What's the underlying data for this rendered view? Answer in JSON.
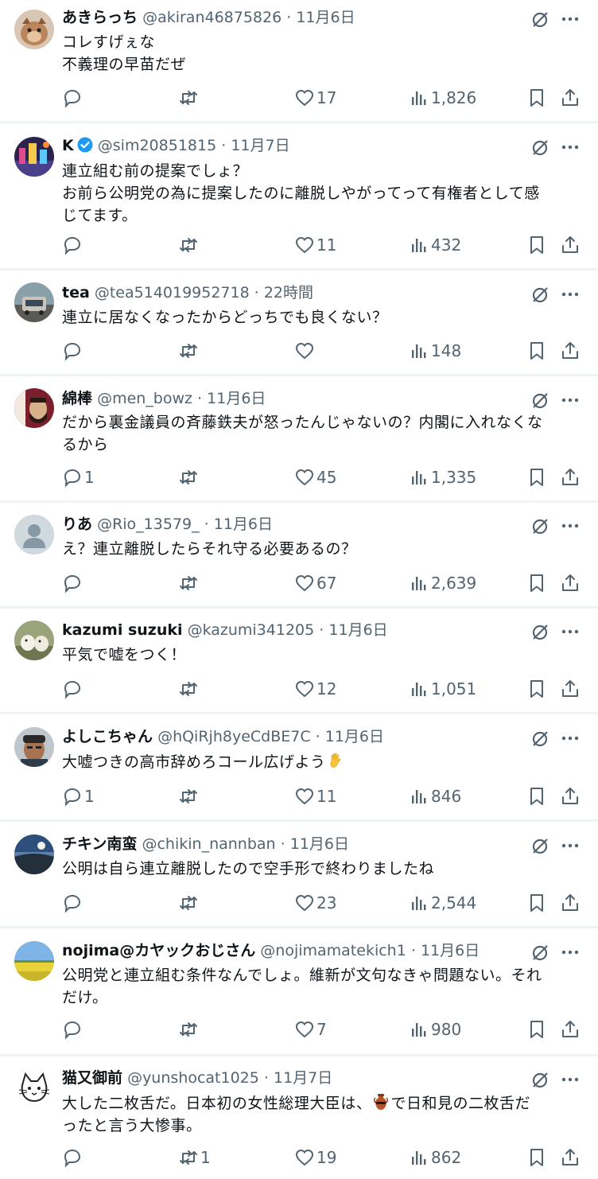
{
  "posts": [
    {
      "name": "あきらっち",
      "verified": false,
      "handle": "@akiran46875826",
      "dot": "·",
      "time": "11月6日",
      "lines": [
        "コレすげぇな",
        "不義理の早苗だぜ"
      ],
      "replies": "",
      "reposts": "",
      "likes": "17",
      "views": "1,826"
    },
    {
      "name": "K",
      "verified": true,
      "handle": "@sim20851815",
      "dot": "·",
      "time": "11月7日",
      "lines": [
        "連立組む前の提案でしょ？",
        "お前ら公明党の為に提案したのに離脱しやがってって有権者として感",
        "じてます。"
      ],
      "replies": "",
      "reposts": "",
      "likes": "11",
      "views": "432"
    },
    {
      "name": "tea",
      "verified": false,
      "handle": "@tea514019952718",
      "dot": "·",
      "time": "22時間",
      "lines": [
        "連立に居なくなったからどっちでも良くない？"
      ],
      "replies": "",
      "reposts": "",
      "likes": "",
      "views": "148"
    },
    {
      "name": "綿棒",
      "verified": false,
      "handle": "@men_bowz",
      "dot": "·",
      "time": "11月6日",
      "lines": [
        "だから裏金議員の斉藤鉄夫が怒ったんじゃないの？内閣に入れなくな",
        "るから"
      ],
      "replies": "1",
      "reposts": "",
      "likes": "45",
      "views": "1,335"
    },
    {
      "name": "りあ",
      "verified": false,
      "handle": "@Rio_13579_",
      "dot": "·",
      "time": "11月6日",
      "lines": [
        "え？連立離脱したらそれ守る必要あるの？"
      ],
      "replies": "",
      "reposts": "",
      "likes": "67",
      "views": "2,639"
    },
    {
      "name": "kazumi suzuki",
      "verified": false,
      "handle": "@kazumi341205",
      "dot": "·",
      "time": "11月6日",
      "lines": [
        "平気で嘘をつく！"
      ],
      "replies": "",
      "reposts": "",
      "likes": "12",
      "views": "1,051"
    },
    {
      "name": "よしこちゃん",
      "verified": false,
      "handle": "@hQiRjh8yeCdBE7C",
      "dot": "·",
      "time": "11月6日",
      "lines": [
        "大嘘つきの高市辞めろコール広げよう"
      ],
      "emoji_after": "hand-emoji",
      "replies": "1",
      "reposts": "",
      "likes": "11",
      "views": "846"
    },
    {
      "name": "チキン南蛮",
      "verified": false,
      "handle": "@chikin_nannban",
      "dot": "·",
      "time": "11月6日",
      "lines": [
        "公明は自ら連立離脱したので空手形で終わりましたね"
      ],
      "replies": "",
      "reposts": "",
      "likes": "23",
      "views": "2,544"
    },
    {
      "name": "nojima@カヤックおじさん",
      "verified": false,
      "handle": "@nojimamatekich1",
      "dot": "·",
      "time": "11月6日",
      "lines": [
        "公明党と連立組む条件なんでしょ。維新が文句なきゃ問題ない。それ",
        "だけ。"
      ],
      "replies": "",
      "reposts": "",
      "likes": "7",
      "views": "980"
    },
    {
      "name": "猫又御前",
      "verified": false,
      "handle": "@yunshocat1025",
      "dot": "·",
      "time": "11月7日",
      "line1_a": "大した二枚舌だ。日本初の女性総理大臣は、",
      "line1_b": "で日和見の二枚舌だ",
      "lines": [
        "",
        "ったと言う大惨事。"
      ],
      "replies": "",
      "reposts": "1",
      "likes": "19",
      "views": "862"
    }
  ],
  "colors": {
    "text": "#0f1419",
    "muted": "#536471",
    "verified": "#1d9bf0",
    "separator": "#eff3f4"
  },
  "icons": [
    "reply-icon",
    "repost-icon",
    "like-icon",
    "views-icon",
    "bookmark-icon",
    "share-icon",
    "grok-icon",
    "more-icon",
    "verified-badge-icon"
  ]
}
